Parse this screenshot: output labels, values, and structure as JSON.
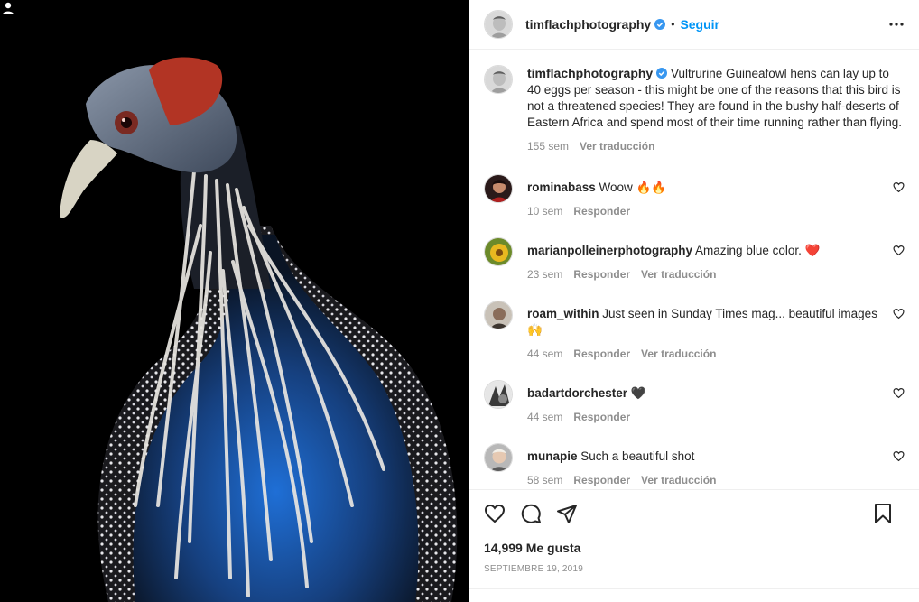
{
  "post": {
    "image_alt": "Vulturine Guineafowl portrait on black background"
  },
  "header": {
    "username": "timflachphotography",
    "separator": "•",
    "follow_label": "Seguir"
  },
  "caption": {
    "username": "timflachphotography",
    "text": "Vultrurine Guineafowl hens can lay up to 40 eggs per season - this might be one of the reasons that this bird is not a threatened species! They are found in the bushy half-deserts of Eastern Africa and spend most of their time running rather than flying.",
    "time": "155 sem",
    "translate": "Ver traducción"
  },
  "comments": [
    {
      "username": "rominabass",
      "text": "Woow 🔥🔥",
      "time": "10 sem",
      "reply": "Responder",
      "translate": ""
    },
    {
      "username": "marianpolleinerphotography",
      "text": "Amazing blue color. ❤️",
      "time": "23 sem",
      "reply": "Responder",
      "translate": "Ver traducción"
    },
    {
      "username": "roam_within",
      "text": "Just seen in Sunday Times mag... beautiful images 🙌",
      "time": "44 sem",
      "reply": "Responder",
      "translate": "Ver traducción"
    },
    {
      "username": "badartdorchester",
      "text": "🖤",
      "time": "44 sem",
      "reply": "Responder",
      "translate": ""
    },
    {
      "username": "munapie",
      "text": "Such a beautiful shot",
      "time": "58 sem",
      "reply": "Responder",
      "translate": "Ver traducción"
    }
  ],
  "footer": {
    "likes": "14,999 Me gusta",
    "date": "SEPTIEMBRE 19, 2019"
  },
  "colors": {
    "accent": "#0095f6",
    "text": "#262626",
    "muted": "#8e8e8e",
    "divider": "#efefef"
  }
}
